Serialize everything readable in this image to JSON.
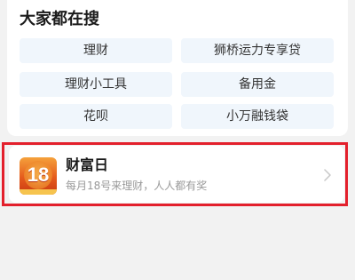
{
  "popular_search": {
    "title": "大家都在搜",
    "chips": [
      "理财",
      "狮桥运力专享贷",
      "理财小工具",
      "备用金",
      "花呗",
      "小万融钱袋"
    ]
  },
  "wealth_day": {
    "badge_number": "18",
    "title": "财富日",
    "subtitle": "每月18号来理财，人人都有奖",
    "icon": "chevron-right-icon"
  },
  "colors": {
    "highlight_border": "#e3202c",
    "chip_background": "#f0f6fc",
    "badge_gradient": [
      "#f5a13b",
      "#c93a12"
    ]
  }
}
